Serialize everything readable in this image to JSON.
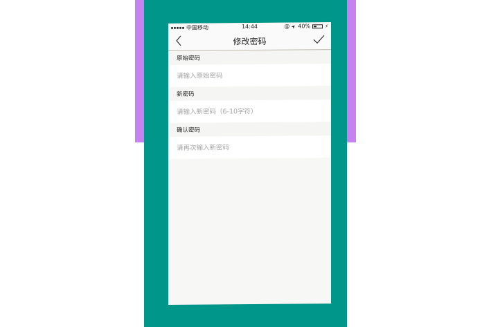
{
  "status_bar": {
    "carrier": "中国移动",
    "time": "14:44",
    "alarm_glyph": "@",
    "location_glyph": "➤",
    "battery_percent_label": "40%",
    "battery_level": 0.4,
    "charging_glyph": "⚡"
  },
  "nav": {
    "title": "修改密码",
    "back_icon": "chevron-left",
    "confirm_icon": "checkmark"
  },
  "form": {
    "original": {
      "label": "原始密码",
      "placeholder": "请输入原始密码",
      "value": ""
    },
    "new": {
      "label": "新密码",
      "placeholder": "请输入新密码（6-10字符）",
      "value": ""
    },
    "confirm": {
      "label": "确认密码",
      "placeholder": "请再次输入新密码",
      "value": ""
    }
  },
  "colors": {
    "background_teal": "#00978a",
    "background_purple": "#c582f0",
    "screen_background": "#f7f7f5"
  }
}
